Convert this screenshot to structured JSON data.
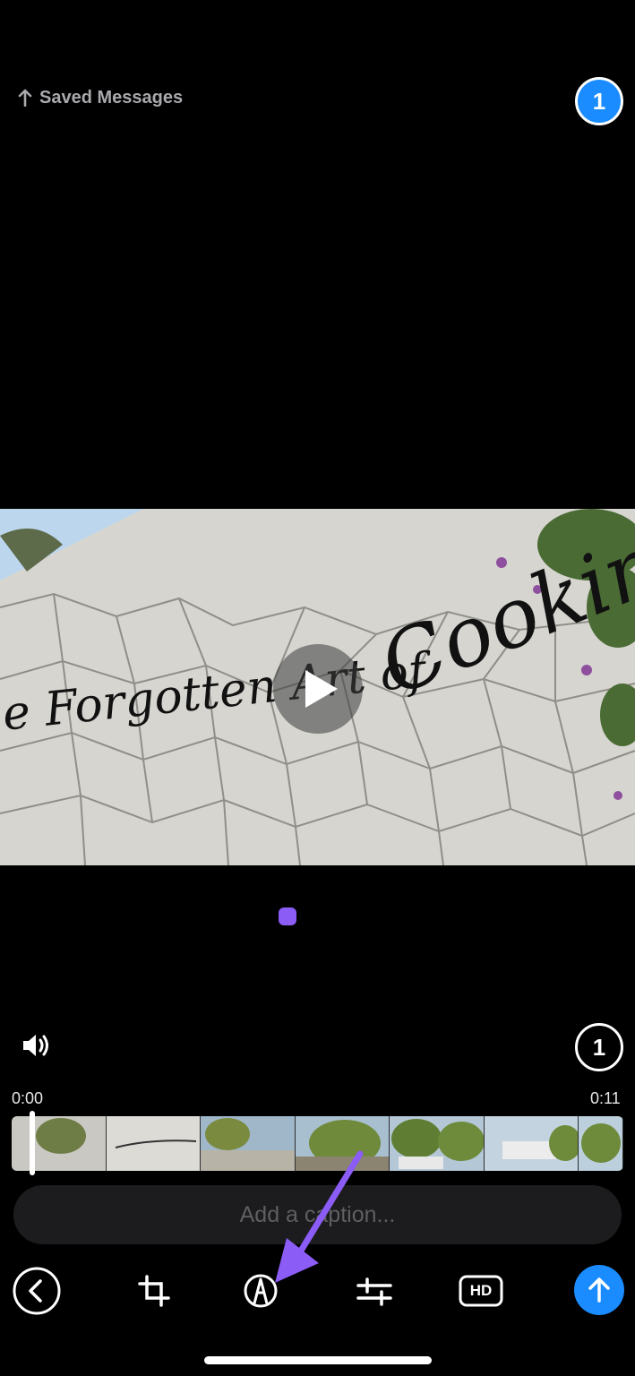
{
  "header": {
    "back_label": "Saved Messages",
    "selection_count": "1"
  },
  "video": {
    "sign_left": "e Forgotten Art of",
    "sign_right": "Cooking"
  },
  "player": {
    "select_count": "1",
    "time_start": "0:00",
    "time_end": "0:11"
  },
  "caption": {
    "placeholder": "Add a caption..."
  },
  "toolbar": {
    "quality_label": "HD"
  },
  "colors": {
    "accent": "#1a8cff",
    "draw_marker": "#8b5cf6",
    "caption_bg": "#1c1c1e"
  },
  "icons": [
    "arrow-up-icon",
    "play-icon",
    "speaker-icon",
    "chevron-left-icon",
    "crop-icon",
    "draw-icon",
    "adjust-icon",
    "hd-icon",
    "send-arrow-icon"
  ]
}
